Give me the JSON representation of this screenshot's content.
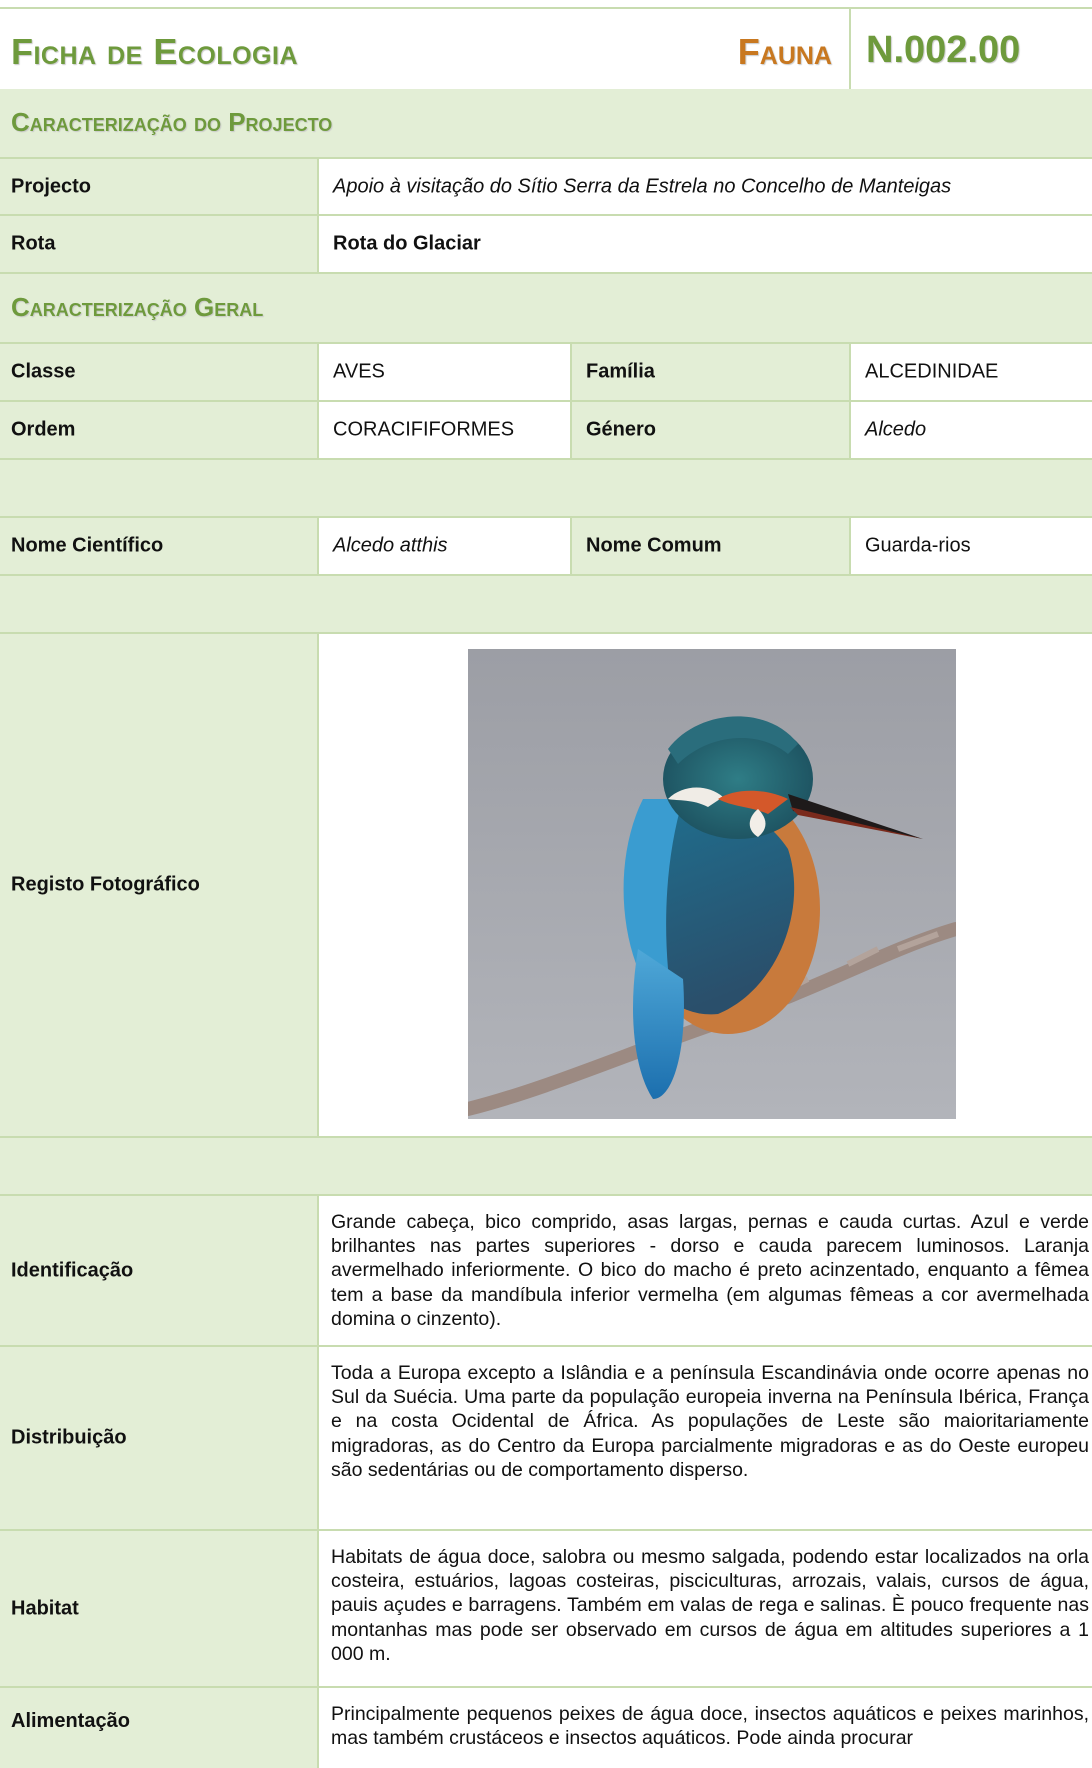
{
  "header": {
    "title": "Ficha de Ecologia",
    "category": "Fauna",
    "code": "N.002.00"
  },
  "project_section": {
    "title": "Caracterização do Projecto",
    "projecto_label": "Projecto",
    "projecto_value": "Apoio à visitação do Sítio Serra da Estrela no Concelho de Manteigas",
    "rota_label": "Rota",
    "rota_value": "Rota do Glaciar"
  },
  "general_section": {
    "title": "Caracterização Geral",
    "classe_label": "Classe",
    "classe_value": "AVES",
    "familia_label": "Família",
    "familia_value": "ALCEDINIDAE",
    "ordem_label": "Ordem",
    "ordem_value": "CORACIFIFORMES",
    "genero_label": "Género",
    "genero_value": "Alcedo",
    "nome_cientifico_label": "Nome Científico",
    "nome_cientifico_value": "Alcedo atthis",
    "nome_comum_label": "Nome Comum",
    "nome_comum_value": "Guarda-rios"
  },
  "photo": {
    "label": "Registo Fotográfico"
  },
  "details": {
    "identificacao_label": "Identificação",
    "identificacao_text": "Grande cabeça, bico comprido, asas largas, pernas e cauda curtas. Azul e verde brilhantes nas partes superiores - dorso e cauda parecem luminosos. Laranja avermelhado inferiormente. O bico do macho é preto acinzentado, enquanto a fêmea tem a base da mandíbula inferior vermelha (em algumas fêmeas a cor avermelhada domina o cinzento).",
    "distribuicao_label": "Distribuição",
    "distribuicao_text": "Toda a Europa excepto a Islândia e a península Escandinávia onde ocorre apenas no Sul da Suécia. Uma parte da população europeia inverna na Península Ibérica, França e na costa Ocidental de África. As populações de Leste são maioritariamente migradoras, as do Centro da Europa parcialmente migradoras e as do Oeste europeu são sedentárias ou de comportamento disperso.",
    "habitat_label": "Habitat",
    "habitat_text": "Habitats de água doce, salobra ou mesmo salgada, podendo estar localizados na orla costeira, estuários, lagoas costeiras, pisciculturas, arrozais, valais, cursos de água, pauis açudes e barragens. Também em valas de rega e salinas. È pouco frequente nas montanhas mas pode ser observado em cursos de água em altitudes superiores a 1 000 m.",
    "alimentacao_label": "Alimentação",
    "alimentacao_text": "Principalmente pequenos peixes de água doce, insectos aquáticos e peixes marinhos, mas também crustáceos e insectos aquáticos. Pode ainda procurar"
  },
  "colors": {
    "green_title": "#6e9a3c",
    "orange_title": "#c87820",
    "label_bg": "#e3eed6",
    "border": "#c8dcb0"
  }
}
